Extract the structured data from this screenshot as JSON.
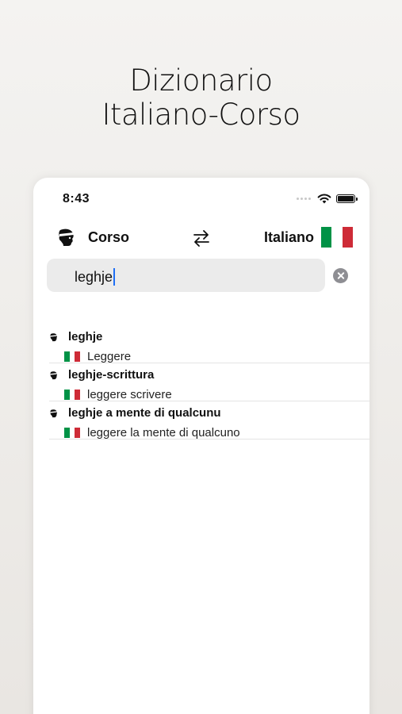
{
  "headline": {
    "line1": "Dizionario",
    "line2": "Italiano-Corso"
  },
  "status_bar": {
    "time": "8:43"
  },
  "language_bar": {
    "source_label": "Corso",
    "target_label": "Italiano",
    "source_icon": "moor-head-icon",
    "swap_icon": "swap-arrows-icon",
    "target_icon": "italian-flag-icon"
  },
  "search": {
    "value": "leghje"
  },
  "results": [
    {
      "word": "leghje",
      "translation": "Leggere"
    },
    {
      "word": "leghje-scrittura",
      "translation": "leggere scrivere"
    },
    {
      "word": "leghje a mente di qualcunu",
      "translation": "leggere la mente di qualcuno"
    }
  ],
  "colors": {
    "flag_green": "#009246",
    "flag_white": "#ffffff",
    "flag_red": "#ce2b37",
    "caret": "#1e6ff5",
    "search_bg": "#ebebeb"
  }
}
